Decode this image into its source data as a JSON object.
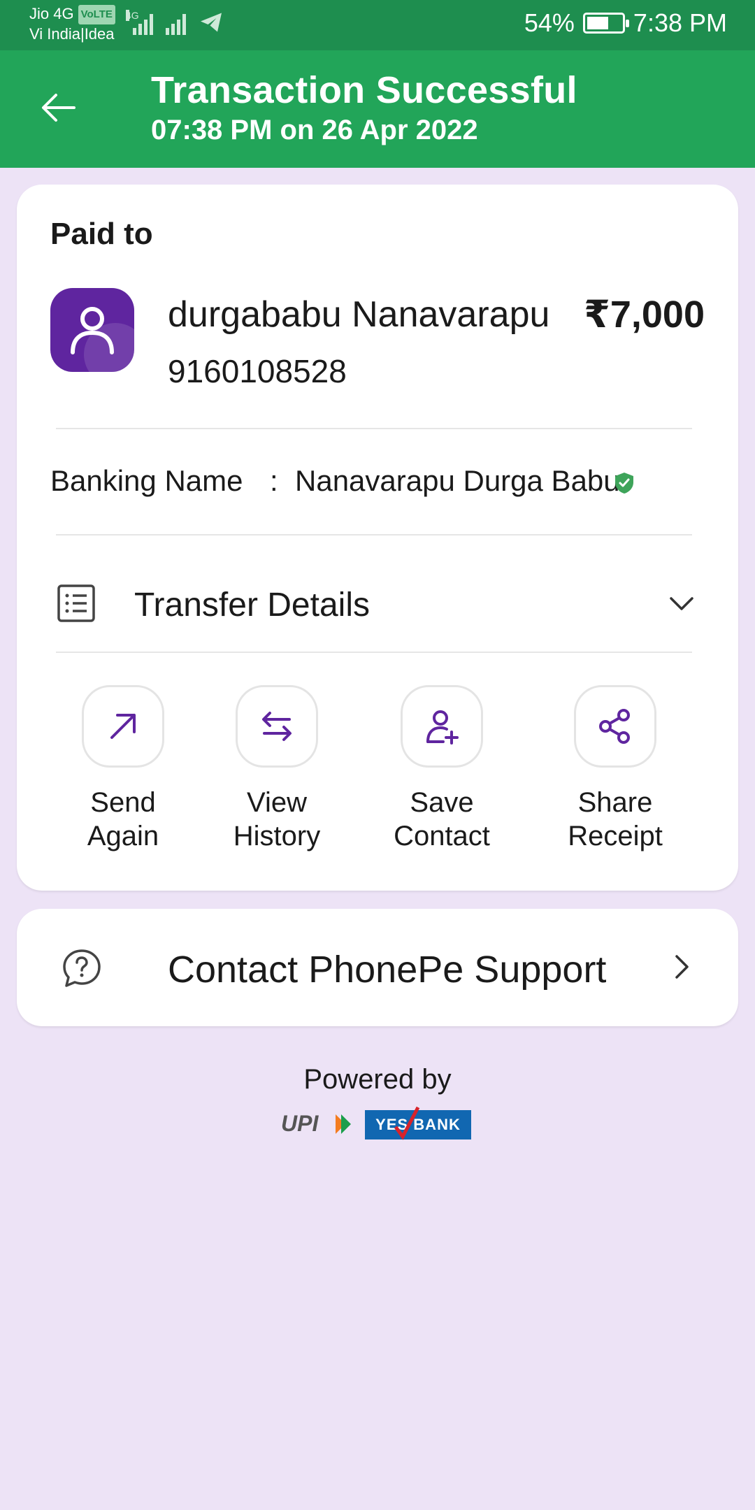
{
  "status_bar": {
    "carrier_1": "Jio 4G",
    "volte": "VoLTE",
    "carrier_2": "Vi India|Idea",
    "network_type": "4G",
    "battery": "54%",
    "time": "7:38 PM"
  },
  "header": {
    "title": "Transaction Successful",
    "subtitle": "07:38 PM on 26 Apr 2022",
    "back_icon": "arrow-left-icon"
  },
  "payment": {
    "paid_to_label": "Paid to",
    "payee_name": "durgababu Nanavarapu",
    "payee_phone": "9160108528",
    "amount": "₹7,000",
    "banking_name_label": "Banking Name",
    "colon": ":",
    "banking_name_value": "Nanavarapu Durga Babu",
    "transfer_details_label": "Transfer Details"
  },
  "actions": [
    {
      "line1": "Send",
      "line2": "Again",
      "icon": "arrow-up-right-icon"
    },
    {
      "line1": "View",
      "line2": "History",
      "icon": "swap-arrows-icon"
    },
    {
      "line1": "Save",
      "line2": "Contact",
      "icon": "user-plus-icon"
    },
    {
      "line1": "Share",
      "line2": "Receipt",
      "icon": "share-icon"
    }
  ],
  "support": {
    "label": "Contact PhonePe Support"
  },
  "footer": {
    "powered_by": "Powered by",
    "upi_text": "UPI",
    "bank_text": "YES BANK"
  },
  "colors": {
    "status_bar": "#1E8E4F",
    "header": "#22A559",
    "page_background": "#EDE3F6",
    "accent_purple": "#5F259F",
    "verified_green": "#3EA45A"
  }
}
